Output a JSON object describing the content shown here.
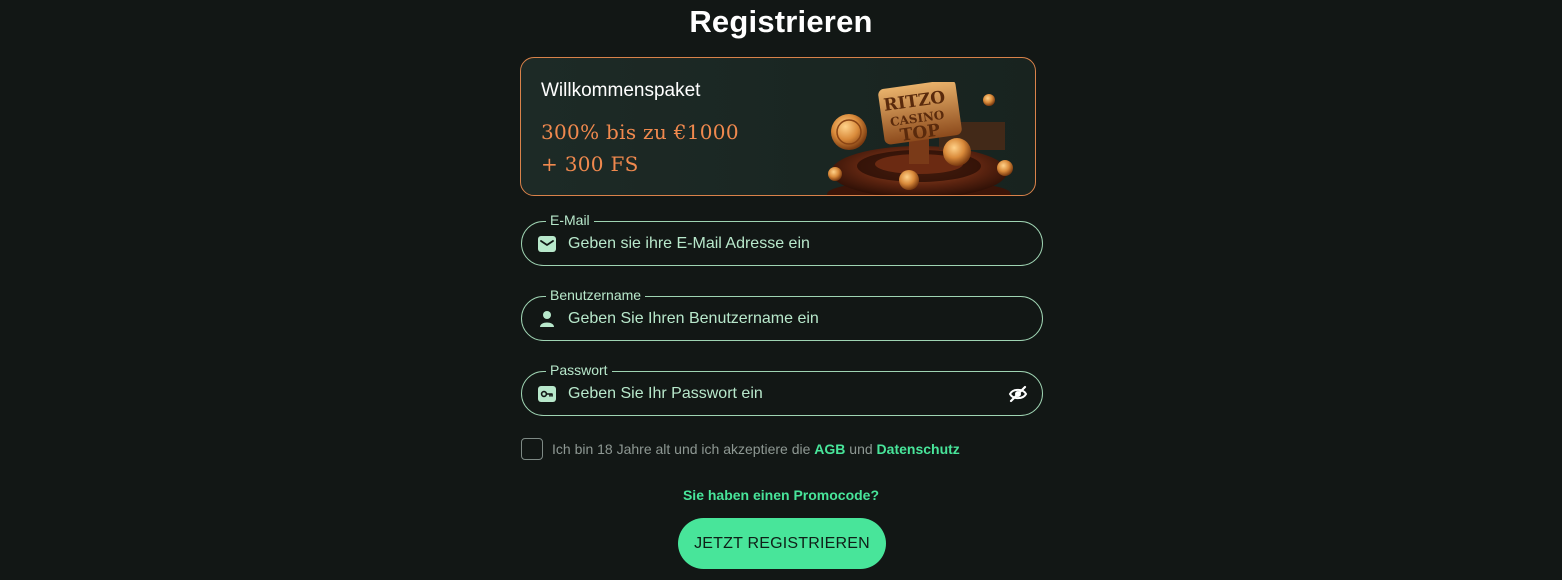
{
  "page": {
    "title": "Registrieren"
  },
  "bonus": {
    "heading": "Willkommenspaket",
    "offer_line1": "300% bis zu €1000",
    "offer_line2": "+ 300 FS",
    "logo_text_1": "RITZO",
    "logo_text_2": "CASINO",
    "logo_text_3": "TOP"
  },
  "form": {
    "email": {
      "label": "E-Mail",
      "placeholder": "Geben sie ihre E-Mail Adresse ein",
      "icon": "envelope-icon"
    },
    "username": {
      "label": "Benutzername",
      "placeholder": "Geben Sie Ihren Benutzername ein",
      "icon": "user-icon"
    },
    "password": {
      "label": "Passwort",
      "placeholder": "Geben Sie Ihr Passwort ein",
      "icon": "key-icon",
      "toggle_icon": "eye-slash-icon"
    }
  },
  "terms": {
    "text_before": "Ich bin 18 Jahre alt und ich akzeptiere die ",
    "agb_link": "AGB",
    "text_middle": " und ",
    "privacy_link": "Datenschutz",
    "checked": false
  },
  "promo": {
    "link_text": "Sie haben einen Promocode?"
  },
  "submit": {
    "label": "JETZT REGISTRIEREN"
  },
  "colors": {
    "background": "#121715",
    "accent_green": "#48e59a",
    "field_border": "#9fd4b3",
    "bonus_border": "#d9824a",
    "bonus_offer": "#f0894e"
  }
}
